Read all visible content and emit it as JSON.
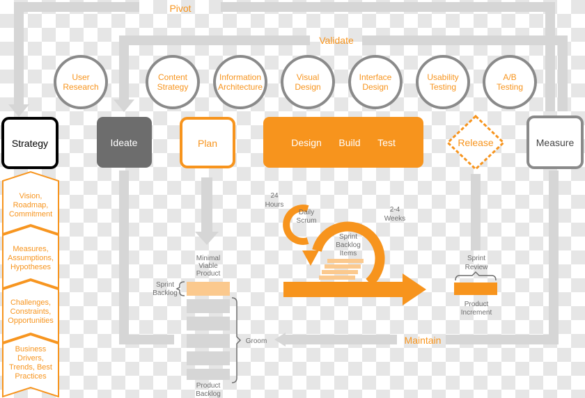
{
  "loops": {
    "pivot": "Pivot",
    "validate": "Validate",
    "maintain": "Maintain",
    "groom": "Groom"
  },
  "colors": {
    "orange": "#f7941d",
    "light_orange": "#fbc98e",
    "grey": "#d6d6d6",
    "dark_grey": "#6d6d6d",
    "mid_grey": "#8a8a8a"
  },
  "activities": [
    {
      "line1": "User",
      "line2": "Research"
    },
    {
      "line1": "Content",
      "line2": "Strategy"
    },
    {
      "line1": "Information",
      "line2": "Architecture"
    },
    {
      "line1": "Visual",
      "line2": "Design"
    },
    {
      "line1": "Interface",
      "line2": "Design"
    },
    {
      "line1": "Usability",
      "line2": "Testing"
    },
    {
      "line1": "A/B",
      "line2": "Testing"
    }
  ],
  "stages": {
    "strategy": "Strategy",
    "ideate": "Ideate",
    "plan": "Plan",
    "design": "Design",
    "build": "Build",
    "test": "Test",
    "release": "Release",
    "measure": "Measure"
  },
  "strategy_items": [
    [
      "Vision,",
      "Roadmap,",
      "Commitment"
    ],
    [
      "Measures,",
      "Assumptions,",
      "Hypotheses"
    ],
    [
      "Challenges,",
      "Constraints,",
      "Opportunities"
    ],
    [
      "Business",
      "Drivers,",
      "Trends, Best",
      "Practices"
    ]
  ],
  "sprint": {
    "mvp": [
      "Minimal",
      "Viable",
      "Product"
    ],
    "sprint_backlog": [
      "Sprint",
      "Backlog"
    ],
    "product_backlog": [
      "Product",
      "Backlog"
    ],
    "hours": [
      "24",
      "Hours"
    ],
    "daily_scrum": [
      "Daily",
      "Scrum"
    ],
    "weeks": [
      "2-4",
      "Weeks"
    ],
    "backlog_items": [
      "Sprint",
      "Backlog",
      "Items"
    ],
    "review": [
      "Sprint",
      "Review"
    ],
    "increment": [
      "Product",
      "Increment"
    ]
  }
}
